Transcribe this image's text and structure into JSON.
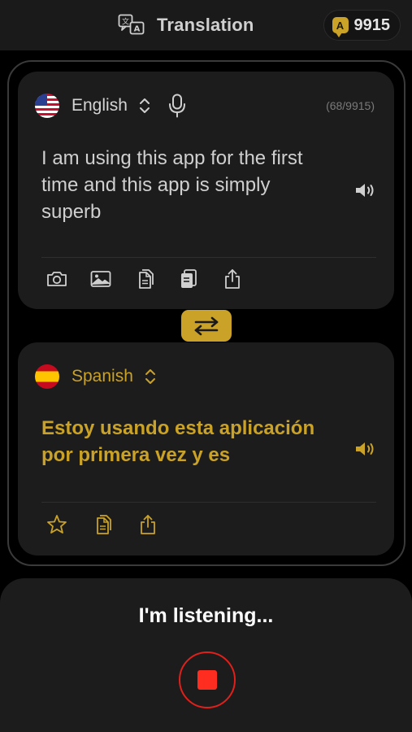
{
  "header": {
    "title": "Translation",
    "title_icon": "translate-icon",
    "credits": "9915",
    "credits_badge_letter": "A"
  },
  "source": {
    "language": "English",
    "flag": "us-flag",
    "counter": "(68/9915)",
    "text": "I am using this app for the first time and this app is simply superb",
    "tools": [
      "camera-icon",
      "image-icon",
      "paste-icon",
      "document-scan-icon",
      "share-icon"
    ]
  },
  "swap": {
    "icon": "swap-arrows-icon"
  },
  "target": {
    "language": "Spanish",
    "flag": "spain-flag",
    "text": "Estoy usando esta aplicación por primera vez y es",
    "tools": [
      "star-icon",
      "copy-icon",
      "share-icon"
    ]
  },
  "listening": {
    "status": "I'm listening...",
    "stop_icon": "stop-record-icon"
  },
  "colors": {
    "accent": "#c9a227",
    "record": "#ff2d1f",
    "card": "#1c1c1c",
    "background": "#000000"
  }
}
